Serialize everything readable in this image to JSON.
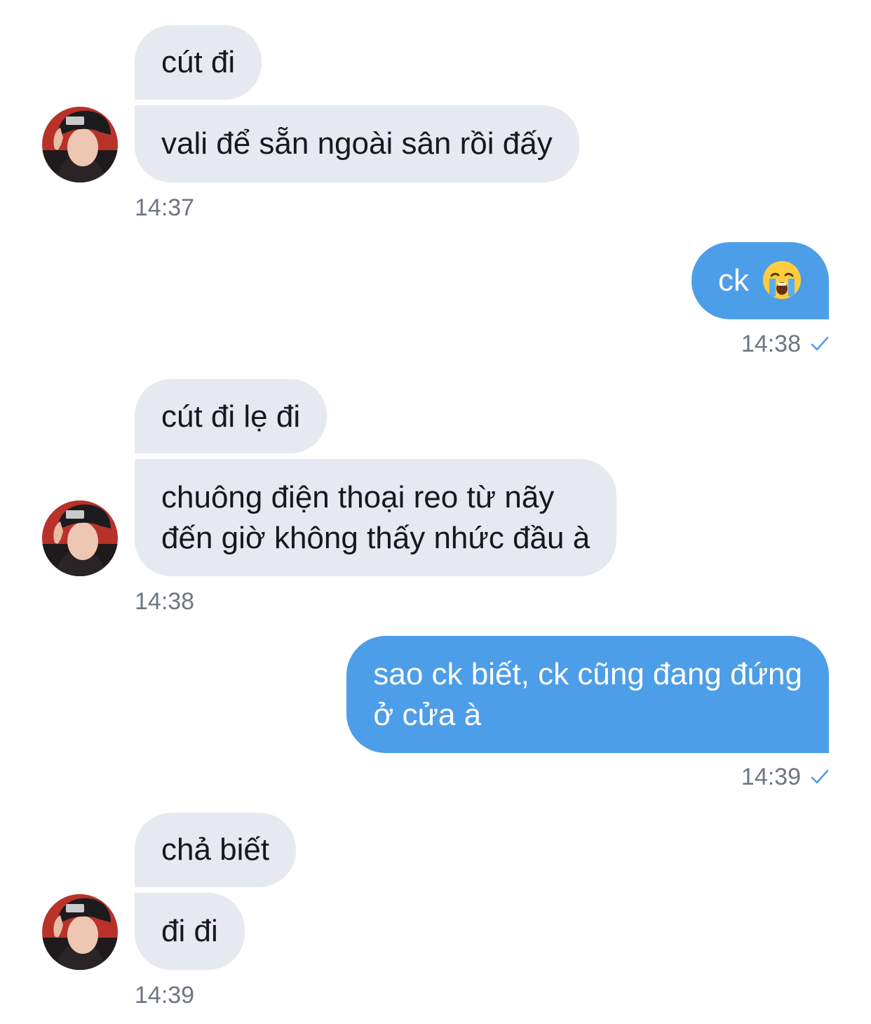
{
  "colors": {
    "incoming_bubble": "#e6e9ef",
    "outgoing_bubble": "#4d9ee8",
    "timestamp": "#6e7681",
    "read_check": "#4d9ee8"
  },
  "messages": [
    {
      "text": "cút đi"
    },
    {
      "text": "vali để sẵn ngoài sân rồi đấy"
    },
    {
      "time": "14:37"
    },
    {
      "text": "ck",
      "emoji": "loudly-crying-face-icon",
      "time": "14:38"
    },
    {
      "text": "cút đi lẹ đi"
    },
    {
      "line1": "chuông điện thoại reo từ nãy",
      "line2": "đến giờ không thấy nhức đầu à"
    },
    {
      "time": "14:38"
    },
    {
      "line1": "sao ck biết, ck cũng đang đứng",
      "line2": "ở cửa à",
      "time": "14:39"
    },
    {
      "text": "chả biết"
    },
    {
      "text": "đi đi"
    },
    {
      "time": "14:39"
    }
  ]
}
